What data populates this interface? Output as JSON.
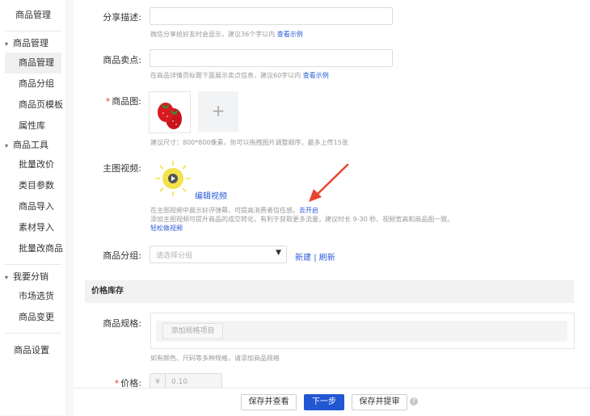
{
  "sidebar": {
    "title": "商品管理",
    "sections": [
      {
        "label": "商品管理",
        "items": [
          "商品管理",
          "商品分组",
          "商品页模板",
          "属性库"
        ]
      },
      {
        "label": "商品工具",
        "items": [
          "批量改价",
          "类目参数",
          "商品导入",
          "素材导入",
          "批量改商品"
        ]
      },
      {
        "label": "我要分销",
        "items": [
          "市场选货",
          "商品变更"
        ]
      }
    ],
    "bottom_item": "商品设置"
  },
  "form": {
    "share": {
      "label": "分享描述:",
      "hint": "微信分享给好友时会显示，建议36个字以内",
      "link": "查看示例"
    },
    "selling": {
      "label": "商品卖点:",
      "hint": "在商品详情页标题下面展示卖点信息，建议60字以内",
      "link": "查看示例"
    },
    "image": {
      "label": "商品图:",
      "required": "*",
      "hint": "建议尺寸：800*800像素，你可以拖拽图片调整顺序，最多上传15张",
      "add": "+"
    },
    "video": {
      "label": "主图视频:",
      "edit_link": "编辑视频",
      "hint1": "在主图视频中展示好评弹幕，可提高消费者信任感。",
      "hint1_link": "去开启",
      "hint2": "添加主图视频可提升商品的成交转化，有利于获取更多流量，建议时长 9-30 秒、视频宽高和商品图一致。",
      "hint3_link": "轻松做视频"
    },
    "group": {
      "label": "商品分组:",
      "placeholder": "请选择分组",
      "new_link": "新建",
      "separator": "|",
      "refresh_link": "刷新"
    },
    "price_section": {
      "title": "价格库存"
    },
    "spec": {
      "label": "商品规格:",
      "add_button": "添加规格项目",
      "hint": "如有颜色、尺码等多种规格，请添加商品规格"
    },
    "price": {
      "label": "价格:",
      "required": "*",
      "currency": "¥",
      "placeholder": "0.10"
    }
  },
  "footer": {
    "save_view": "保存并查看",
    "next": "下一步",
    "save_audit": "保存并提审",
    "help_icon": "question-circle-icon"
  },
  "colors": {
    "link": "#2a5bd7",
    "primary": "#2157d3",
    "arrow": "#e8452c"
  }
}
